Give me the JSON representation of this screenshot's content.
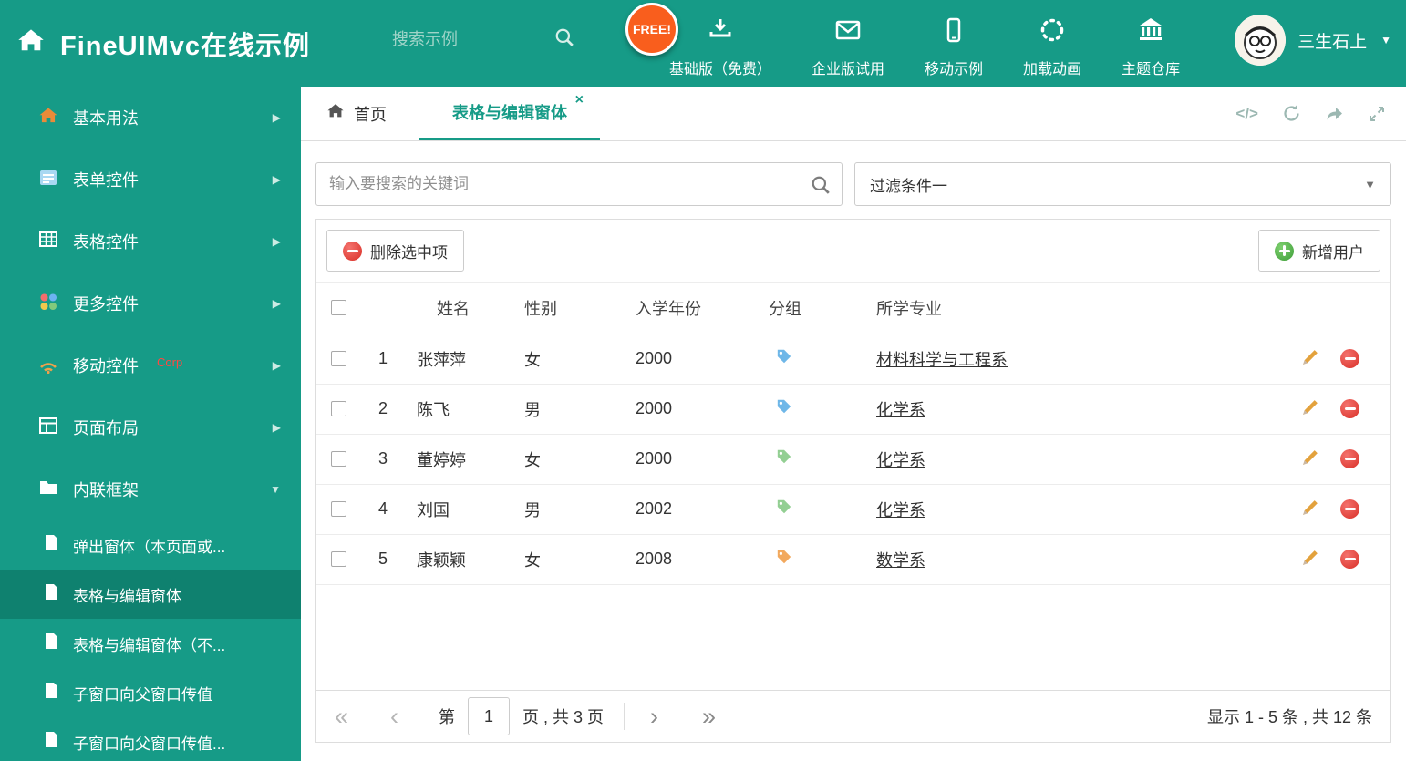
{
  "colors": {
    "accent": "#169b87",
    "sidebar_selected": "#0f816f",
    "danger": "#dd3b36",
    "success": "#4db348",
    "free_badge": "#f95e1d"
  },
  "icons": {
    "code": "</>",
    "caret_down": "▼",
    "arrow_right": "▶",
    "arrow_down": "▼",
    "close": "×",
    "prev_all": "«",
    "prev": "‹",
    "next": "›",
    "next_all": "»"
  },
  "header": {
    "title": "FineUIMvc在线示例",
    "search_placeholder": "搜索示例",
    "free_badge": "FREE!",
    "nav": [
      {
        "label": "基础版（免费）"
      },
      {
        "label": "企业版试用"
      },
      {
        "label": "移动示例"
      },
      {
        "label": "加载动画"
      },
      {
        "label": "主题仓库"
      }
    ],
    "user_name": "三生石上"
  },
  "sidebar": {
    "items": [
      {
        "label": "基本用法"
      },
      {
        "label": "表单控件"
      },
      {
        "label": "表格控件"
      },
      {
        "label": "更多控件"
      },
      {
        "label": "移动控件",
        "badge": "Corp"
      },
      {
        "label": "页面布局"
      },
      {
        "label": "内联框架"
      }
    ],
    "subitems": [
      {
        "label": "弹出窗体（本页面或..."
      },
      {
        "label": "表格与编辑窗体"
      },
      {
        "label": "表格与编辑窗体（不..."
      },
      {
        "label": "子窗口向父窗口传值"
      },
      {
        "label": "子窗口向父窗口传值..."
      }
    ]
  },
  "main": {
    "tabs": [
      {
        "label": "首页"
      },
      {
        "label": "表格与编辑窗体"
      }
    ],
    "filter": {
      "search_placeholder": "输入要搜索的关键词",
      "selected_filter": "过滤条件一"
    },
    "toolbar": {
      "delete_label": "删除选中项",
      "add_label": "新增用户"
    },
    "table": {
      "headers": {
        "name": "姓名",
        "gender": "性别",
        "year": "入学年份",
        "group": "分组",
        "major": "所学专业"
      },
      "rows": [
        {
          "num": "1",
          "name": "张萍萍",
          "gender": "女",
          "year": "2000",
          "tag_color": "#6fb7e8",
          "major": "材料科学与工程系"
        },
        {
          "num": "2",
          "name": "陈飞",
          "gender": "男",
          "year": "2000",
          "tag_color": "#6fb7e8",
          "major": "化学系"
        },
        {
          "num": "3",
          "name": "董婷婷",
          "gender": "女",
          "year": "2000",
          "tag_color": "#93cf93",
          "major": "化学系"
        },
        {
          "num": "4",
          "name": "刘国",
          "gender": "男",
          "year": "2002",
          "tag_color": "#93cf93",
          "major": "化学系"
        },
        {
          "num": "5",
          "name": "康颖颖",
          "gender": "女",
          "year": "2008",
          "tag_color": "#f2a95e",
          "major": "数学系"
        }
      ]
    },
    "pagination": {
      "page_label_prefix": "第",
      "page": "1",
      "page_label_suffix": "页 , 共 3 页",
      "summary": "显示 1 - 5 条 , 共 12 条"
    }
  }
}
